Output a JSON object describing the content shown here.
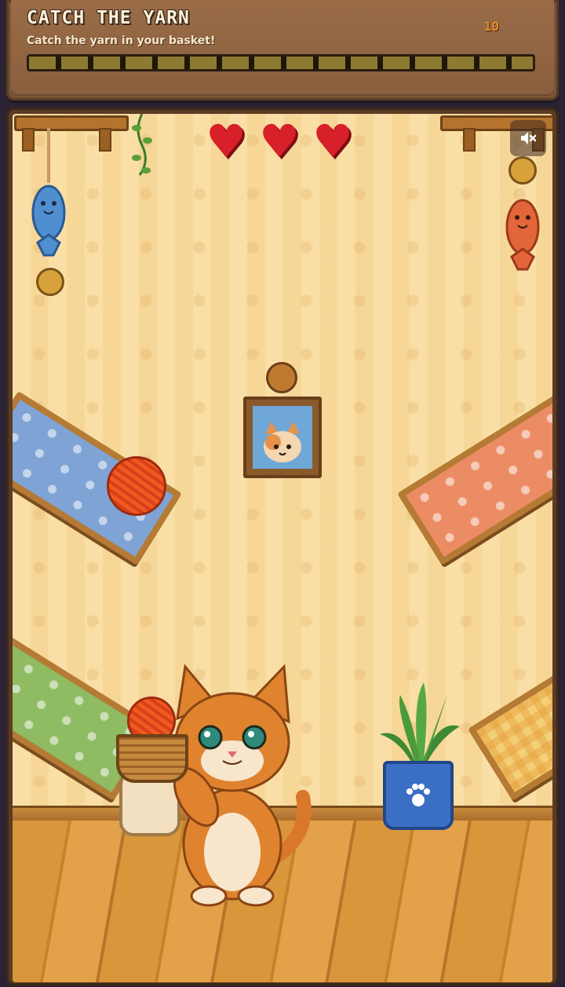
{
  "hud": {
    "title": "CATCH THE YARN",
    "subtitle": "Catch the yarn in your basket!",
    "score": "10",
    "progress_fraction": 1.0
  },
  "game": {
    "lives": 3,
    "life_icon": "heart-icon",
    "mute_icon": "speaker-muted-icon",
    "colors": {
      "heart": "#d8202a",
      "wall": "#f7d99a",
      "floor": "#d9963a",
      "yarn": "#f05a1e",
      "progress": "#8c7a32"
    }
  }
}
